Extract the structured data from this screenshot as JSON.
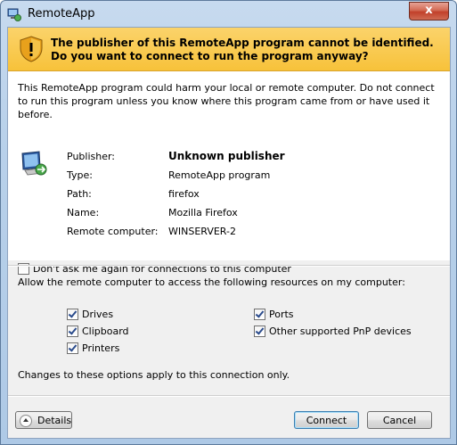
{
  "window": {
    "title": "RemoteApp",
    "close_label": "x"
  },
  "banner": {
    "text": "The publisher of this RemoteApp program cannot be identified. Do you want to connect to run the program anyway?"
  },
  "warning": "This RemoteApp program could harm your local or remote computer. Do not connect to run this program unless you know where this program came from or have used it before.",
  "details": [
    {
      "label": "Publisher:",
      "value": "Unknown publisher"
    },
    {
      "label": "Type:",
      "value": "RemoteApp program"
    },
    {
      "label": "Path:",
      "value": "firefox"
    },
    {
      "label": "Name:",
      "value": "Mozilla Firefox"
    },
    {
      "label": "Remote computer:",
      "value": "WINSERVER-2"
    }
  ],
  "dont_ask": {
    "label": "Don't ask me again for connections to this computer",
    "checked": false
  },
  "resources": {
    "heading": "Allow the remote computer to access the following resources on my computer:",
    "items": [
      {
        "label": "Drives",
        "checked": true
      },
      {
        "label": "Clipboard",
        "checked": true
      },
      {
        "label": "Printers",
        "checked": true
      },
      {
        "label": "Ports",
        "checked": true
      },
      {
        "label": "Other supported PnP devices",
        "checked": true
      }
    ],
    "note": "Changes to these options apply to this connection only."
  },
  "buttons": {
    "details": "Details",
    "connect": "Connect",
    "cancel": "Cancel"
  }
}
